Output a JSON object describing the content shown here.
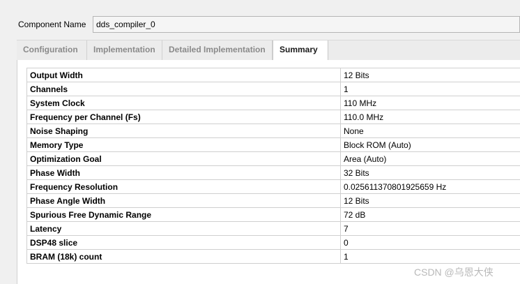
{
  "component": {
    "label": "Component Name",
    "value": "dds_compiler_0"
  },
  "tabs": [
    {
      "label": "Configuration",
      "active": false
    },
    {
      "label": "Implementation",
      "active": false
    },
    {
      "label": "Detailed Implementation",
      "active": false
    },
    {
      "label": "Summary",
      "active": true
    }
  ],
  "summary": {
    "rows": [
      {
        "key": "Output Width",
        "value": "12 Bits"
      },
      {
        "key": "Channels",
        "value": "1"
      },
      {
        "key": "System Clock",
        "value": "110 MHz"
      },
      {
        "key": "Frequency per Channel (Fs)",
        "value": "110.0 MHz"
      },
      {
        "key": "Noise Shaping",
        "value": "None"
      },
      {
        "key": "Memory Type",
        "value": "Block ROM (Auto)"
      },
      {
        "key": "Optimization Goal",
        "value": "Area (Auto)"
      },
      {
        "key": "Phase Width",
        "value": "32 Bits"
      },
      {
        "key": "Frequency Resolution",
        "value": "0.025611370801925659 Hz"
      },
      {
        "key": "Phase Angle Width",
        "value": "12 Bits"
      },
      {
        "key": "Spurious Free Dynamic Range",
        "value": "72 dB"
      },
      {
        "key": "Latency",
        "value": "7"
      },
      {
        "key": "DSP48 slice",
        "value": "0"
      },
      {
        "key": "BRAM (18k) count",
        "value": "1"
      }
    ]
  },
  "watermark": "CSDN @乌恩大侠"
}
